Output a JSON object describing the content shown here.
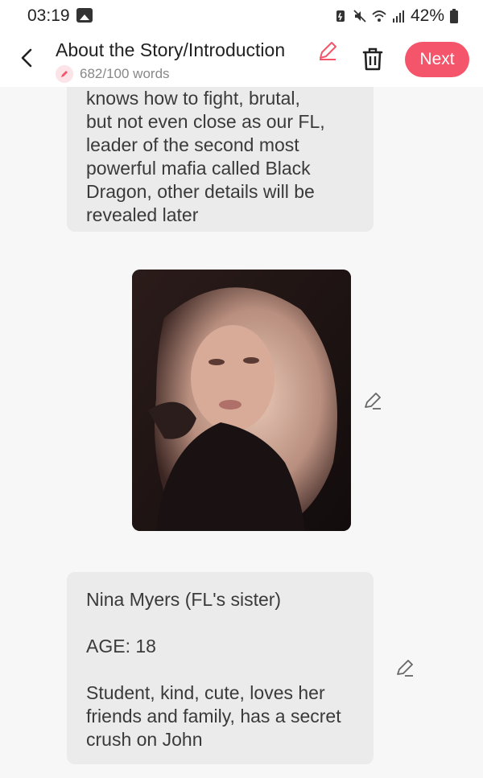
{
  "status_bar": {
    "time": "03:19",
    "battery": "42%"
  },
  "header": {
    "title": "About the Story/Introduction",
    "word_count": "682/100 words",
    "next_label": "Next"
  },
  "blocks": {
    "intro_lines": [
      "knows how to fight, brutal,",
      "but not even close as our FL,",
      "leader of the second most",
      "powerful mafia called Black",
      "Dragon, other details will be",
      "revealed later"
    ],
    "character": {
      "name": "Nina Myers (FL's sister)",
      "age": "AGE: 18",
      "description": "Student, kind, cute, loves her friends and family, has a secret crush on John"
    }
  },
  "colors": {
    "accent": "#f4556b",
    "card": "#ebebeb",
    "background": "#f7f7f7"
  },
  "icons": {
    "back": "chevron-left-icon",
    "title_edit": "pencil-icon",
    "trash": "trash-icon",
    "block_edit": "pencil-icon"
  }
}
